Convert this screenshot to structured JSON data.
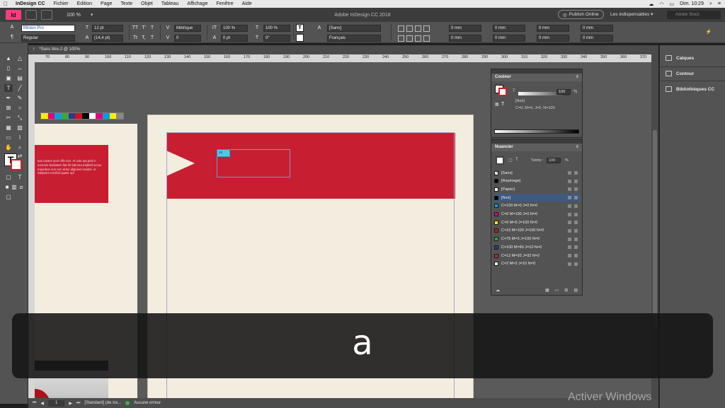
{
  "menubar": {
    "items": [
      "InDesign CC",
      "Fichier",
      "Edition",
      "Page",
      "Texte",
      "Objet",
      "Tableau",
      "Affichage",
      "Fenêtre",
      "Aide"
    ],
    "clock": "Dim. 10:29"
  },
  "appbar": {
    "logo": "Id",
    "zoom": "100 %",
    "title": "Adobe InDesign CC 2018",
    "publish": "Publish Online",
    "workspace": "Les indispensables",
    "search_placeholder": "Adobe Stock"
  },
  "control": {
    "font_family": "Minion Pro",
    "font_style": "Regular",
    "font_size": "12 pt",
    "leading": "(14,4 pt)",
    "kerning": "Métrique",
    "tracking": "0",
    "vscale": "100 %",
    "hscale": "100 %",
    "baseline": "0 pt",
    "skew": "0°",
    "char_style": "[Sans]",
    "language": "Français",
    "mm_fields": [
      "0 mm",
      "0 mm",
      "0 mm",
      "0 mm",
      "0 mm",
      "0 mm",
      "0 mm",
      "0 mm",
      "0 mm",
      "0 mm"
    ]
  },
  "document": {
    "tab_title": "*Sans titre-2 @ 100%",
    "ruler_ticks": [
      "70",
      "80",
      "90",
      "100",
      "110",
      "120",
      "130",
      "140",
      "150",
      "160",
      "170",
      "180",
      "190",
      "200",
      "210",
      "220",
      "230",
      "240",
      "250",
      "260",
      "270",
      "280",
      "290",
      "300",
      "310",
      "320",
      "330",
      "340",
      "350",
      "360",
      "370"
    ],
    "left_page_text": "aos carites acet offic tion. At vole aut ped in exeraim faciliatem fait hit laborea traditeil secus mauribus non rem dolor aligniect incidat. ut valipsam remihit iquatic upl",
    "text_cursor_label": "|a|"
  },
  "status": {
    "page": "1",
    "master": "[Standard] (de tra...",
    "preflight": "Aucune erreur"
  },
  "dock": {
    "items": [
      "Calques",
      "Contour",
      "Bibliothèques CC"
    ]
  },
  "couleur_panel": {
    "title": "Couleur",
    "channel": "T",
    "value": "100",
    "unit": "%",
    "swatch_name": "[Noir]",
    "values_text": "C=0, M=0, J=0, N=100"
  },
  "nuancier_panel": {
    "title": "Nuancier",
    "tint_label": "Teinte :",
    "tint_value": "100",
    "tint_unit": "%",
    "swatches": [
      {
        "name": "[Sans]",
        "color": "#ffffff",
        "none": true
      },
      {
        "name": "[Repérage]",
        "color": "#000000"
      },
      {
        "name": "[Papier]",
        "color": "#ffffff"
      },
      {
        "name": "[Noir]",
        "color": "#000000",
        "selected": true
      },
      {
        "name": "C=100 M=0 J=0 N=0",
        "color": "#00a0e0"
      },
      {
        "name": "C=0 M=100 J=0 N=0",
        "color": "#e6007e"
      },
      {
        "name": "C=0 M=0 J=100 N=0",
        "color": "#ffed00"
      },
      {
        "name": "C=15 M=100 J=100 N=0",
        "color": "#d0131c"
      },
      {
        "name": "C=75 M=5 J=100 N=0",
        "color": "#3aa935"
      },
      {
        "name": "C=100 M=90 J=10 N=0",
        "color": "#2a3a90"
      },
      {
        "name": "C=12 M=93 J=92 N=2",
        "color": "#c8242a"
      },
      {
        "name": "C=2 M=2 J=10 N=0",
        "color": "#f7f1df"
      }
    ]
  },
  "swatch_strip_colors": [
    "#ffed00",
    "#e6007e",
    "#00a0e0",
    "#3aa935",
    "#2a3a90",
    "#d0131c",
    "#000000",
    "#ffffff",
    "#e6007e",
    "#00a0e0",
    "#ffed00",
    "#888888"
  ],
  "caption": {
    "text": "a"
  },
  "watermark": "Activer Windows"
}
